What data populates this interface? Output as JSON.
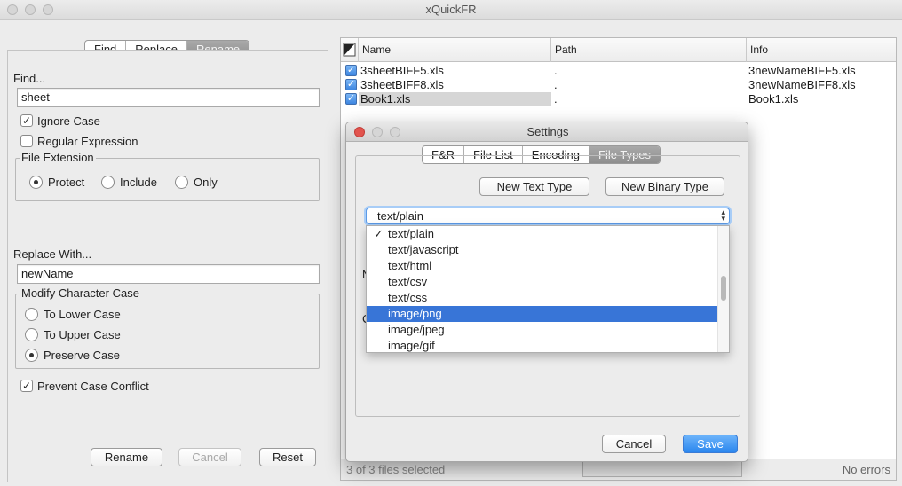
{
  "window": {
    "title": "xQuickFR"
  },
  "left_panel": {
    "tabs": [
      {
        "label": "Find",
        "selected": false
      },
      {
        "label": "Replace",
        "selected": false
      },
      {
        "label": "Rename",
        "selected": true
      }
    ],
    "find": {
      "label": "Find...",
      "value": "sheet",
      "ignore_case": {
        "label": "Ignore Case",
        "checked": true
      },
      "regex": {
        "label": "Regular Expression",
        "checked": false
      },
      "file_extension": {
        "legend": "File Extension",
        "options": [
          {
            "label": "Protect",
            "selected": true
          },
          {
            "label": "Include",
            "selected": false
          },
          {
            "label": "Only",
            "selected": false
          }
        ]
      }
    },
    "replace": {
      "label": "Replace With...",
      "value": "newName",
      "modify_case": {
        "legend": "Modify Character Case",
        "options": [
          {
            "label": "To Lower Case",
            "selected": false
          },
          {
            "label": "To Upper Case",
            "selected": false
          },
          {
            "label": "Preserve Case",
            "selected": true
          }
        ]
      },
      "prevent_conflict": {
        "label": "Prevent Case Conflict",
        "checked": true
      }
    },
    "buttons": {
      "rename": "Rename",
      "cancel": "Cancel",
      "reset": "Reset"
    }
  },
  "file_table": {
    "columns": [
      "Name",
      "Path",
      "Info"
    ],
    "rows": [
      {
        "name": "3sheetBIFF5.xls",
        "path": ".",
        "info": "3newNameBIFF5.xls",
        "checked": true
      },
      {
        "name": "3sheetBIFF8.xls",
        "path": ".",
        "info": "3newNameBIFF8.xls",
        "checked": true
      },
      {
        "name": "Book1.xls",
        "path": ".",
        "info": "Book1.xls",
        "checked": true
      }
    ],
    "status": "3 of 3 files selected",
    "errors": "No errors"
  },
  "settings_dialog": {
    "title": "Settings",
    "tabs": [
      {
        "label": "F&R",
        "selected": false
      },
      {
        "label": "File List",
        "selected": false
      },
      {
        "label": "Encoding",
        "selected": false
      },
      {
        "label": "File Types",
        "selected": true
      }
    ],
    "new_text_type": "New Text Type",
    "new_binary_type": "New Binary Type",
    "combo_value": "text/plain",
    "combo_options": [
      {
        "label": "text/plain",
        "checked": true
      },
      {
        "label": "text/javascript"
      },
      {
        "label": "text/html"
      },
      {
        "label": "text/csv"
      },
      {
        "label": "text/css"
      },
      {
        "label": "image/png",
        "highlighted": true
      },
      {
        "label": "image/jpeg"
      },
      {
        "label": "image/gif"
      }
    ],
    "partial_label_1": "N",
    "partial_label_2": "C",
    "cancel": "Cancel",
    "save": "Save",
    "check_glyph": "✓"
  }
}
